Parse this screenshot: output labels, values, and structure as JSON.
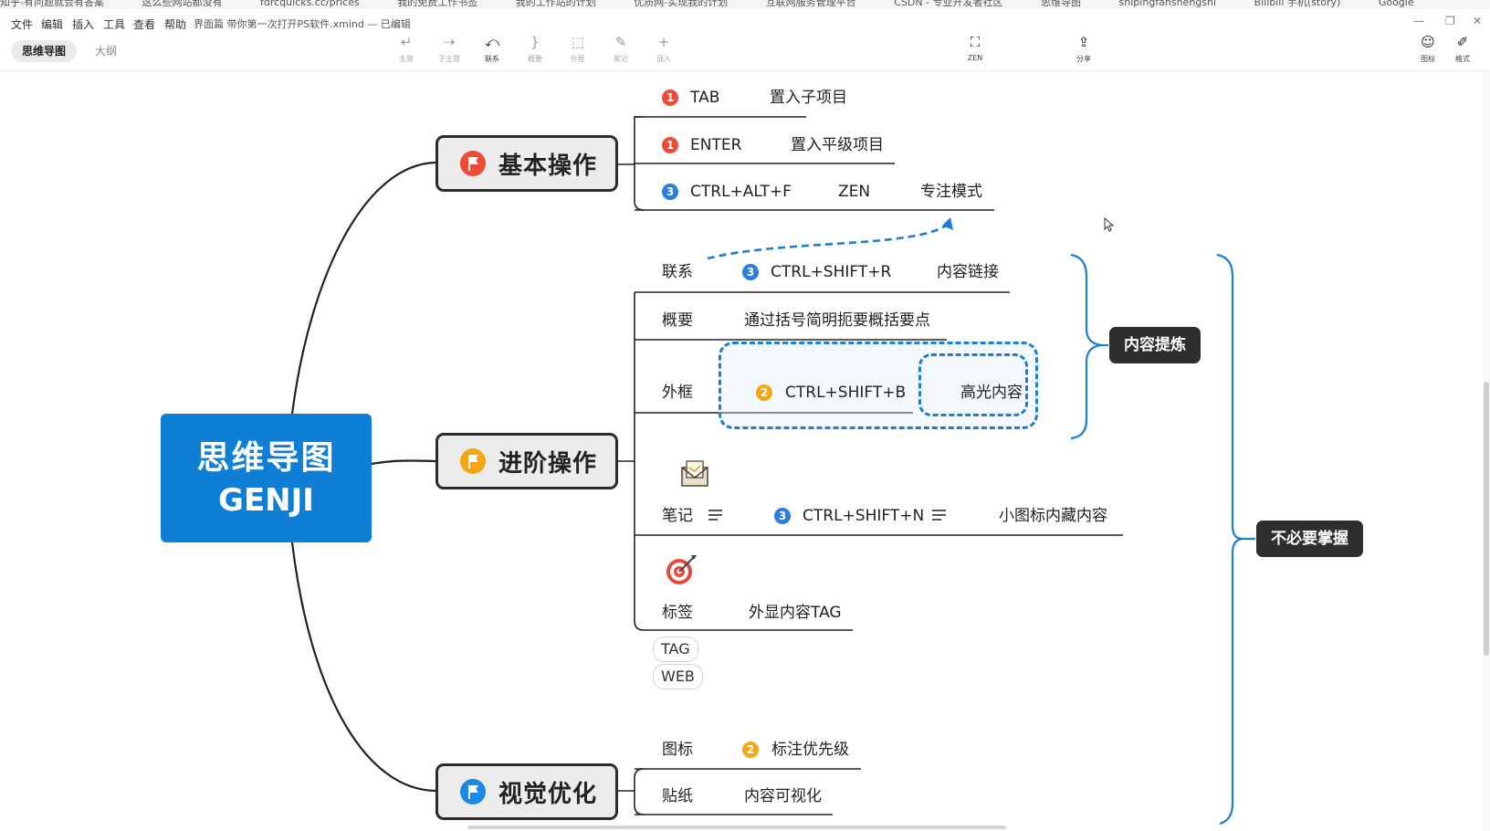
{
  "browser": {
    "bookmarks": [
      "知乎-有问题就会有答案",
      "这么些网站都没有",
      "fdrcquicks.cc/prices",
      "我的免费工作书签",
      "我的工作站的计划",
      "优质网-实现我的计划",
      "互联网服务管理平台",
      "CSDN - 专业开发者社区",
      "思维导图",
      "shipingfanshengshi",
      "Bilibili 手机(story)",
      "Google"
    ]
  },
  "app": {
    "menu": [
      "文件",
      "编辑",
      "插入",
      "工具",
      "查看",
      "帮助"
    ],
    "document_title": "界面篇 带你第一次打开PS软件.xmind — 已编辑",
    "mode_tabs": {
      "mindmap": "思维导图",
      "outline": "大纲"
    },
    "toolbar": {
      "topic": "主题",
      "subtopic": "子主题",
      "relationship": "联系",
      "summary": "概要",
      "boundary": "外框",
      "note": "笔记",
      "insert": "插入",
      "zen": "ZEN",
      "share": "分享",
      "icon": "图标",
      "format": "格式"
    }
  },
  "mindmap": {
    "central": {
      "line1": "思维导图",
      "line2": "GENJI",
      "color": "#0f7fd6"
    },
    "basic": {
      "title": "基本操作",
      "flag_color": "#ef4a36",
      "items": [
        {
          "badge": "1",
          "key": "TAB",
          "desc": "置入子项目"
        },
        {
          "badge": "1",
          "key": "ENTER",
          "desc": "置入平级项目"
        },
        {
          "badge": "3",
          "key": "CTRL+ALT+F",
          "mode": "ZEN",
          "desc": "专注模式"
        }
      ]
    },
    "advanced": {
      "title": "进阶操作",
      "flag_color": "#f3a712",
      "relationship": {
        "label": "联系",
        "badge": "3",
        "key": "CTRL+SHIFT+R",
        "desc": "内容链接"
      },
      "summary": {
        "label": "概要",
        "desc": "通过括号简明扼要概括要点"
      },
      "boundary": {
        "label": "外框",
        "badge": "2",
        "key": "CTRL+SHIFT+B",
        "desc": "高光内容"
      },
      "note": {
        "label": "笔记",
        "badge": "3",
        "key": "CTRL+SHIFT+N",
        "desc": "小图标内藏内容"
      },
      "tag": {
        "label": "标签",
        "desc": "外显内容TAG",
        "tags": [
          "TAG",
          "WEB"
        ]
      }
    },
    "visual": {
      "title": "视觉优化",
      "flag_color": "#1e88e5",
      "items": [
        {
          "label": "图标",
          "badge": "2",
          "desc": "标注优先级"
        },
        {
          "label": "贴纸",
          "desc": "内容可视化"
        }
      ]
    },
    "summaries": {
      "content_refine": "内容提炼",
      "not_required": "不必要掌握"
    }
  }
}
